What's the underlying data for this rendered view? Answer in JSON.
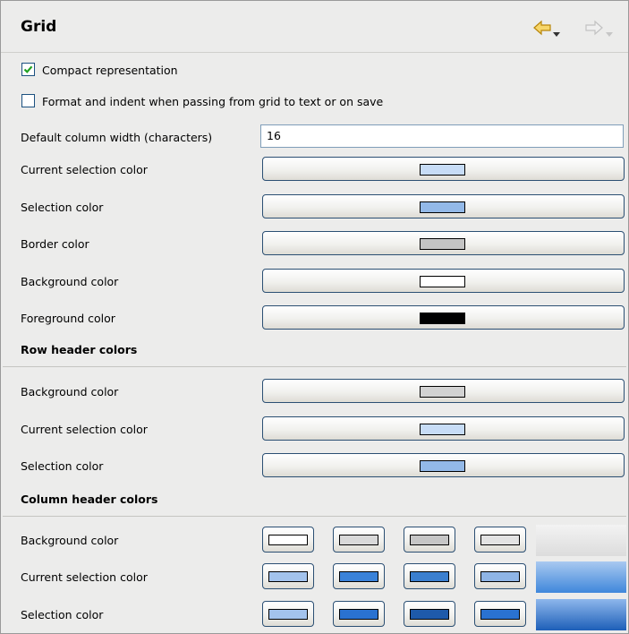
{
  "header": {
    "title": "Grid",
    "back_icon": "back-arrow-icon",
    "forward_icon": "forward-arrow-icon"
  },
  "options": {
    "compact": {
      "label": "Compact representation",
      "checked": true
    },
    "format": {
      "label": "Format and indent when passing from grid to text or on save",
      "checked": false
    },
    "default_width": {
      "label": "Default column width (characters)",
      "value": "16"
    }
  },
  "grid_colors": [
    {
      "label": "Current selection color",
      "color": "#c7dcf6"
    },
    {
      "label": "Selection color",
      "color": "#93b9e8"
    },
    {
      "label": "Border color",
      "color": "#c4c4c4"
    },
    {
      "label": "Background color",
      "color": "#ffffff"
    },
    {
      "label": "Foreground color",
      "color": "#000000"
    }
  ],
  "row_header": {
    "title": "Row header colors",
    "rows": [
      {
        "label": "Background color",
        "color": "#d2d2d2"
      },
      {
        "label": "Current selection color",
        "color": "#c7dcf6"
      },
      {
        "label": "Selection color",
        "color": "#93b9e8"
      }
    ]
  },
  "column_header": {
    "title": "Column header colors",
    "rows": [
      {
        "label": "Background color",
        "swatches": [
          "#ffffff",
          "#d9d9d9",
          "#c6c6c6",
          "#e3e3e3"
        ],
        "preview": [
          "#f3f3f3",
          "#dcdcdc"
        ]
      },
      {
        "label": "Current selection color",
        "swatches": [
          "#a3c3ed",
          "#3a82d9",
          "#3b7fcf",
          "#8fb5e6"
        ],
        "preview": [
          "#a9c9f0",
          "#3f87db"
        ]
      },
      {
        "label": "Selection color",
        "swatches": [
          "#a3c3ed",
          "#2a72d1",
          "#1e5aaa",
          "#2a72d1"
        ],
        "preview": [
          "#8eb7ec",
          "#1d5fb8"
        ]
      }
    ]
  },
  "colors": {
    "background": "#ececeb",
    "button_border": "#2b4f73",
    "check_green": "#21a121",
    "arrow_yellow": "#f2c94a",
    "arrow_disabled": "#c9c9c9"
  }
}
